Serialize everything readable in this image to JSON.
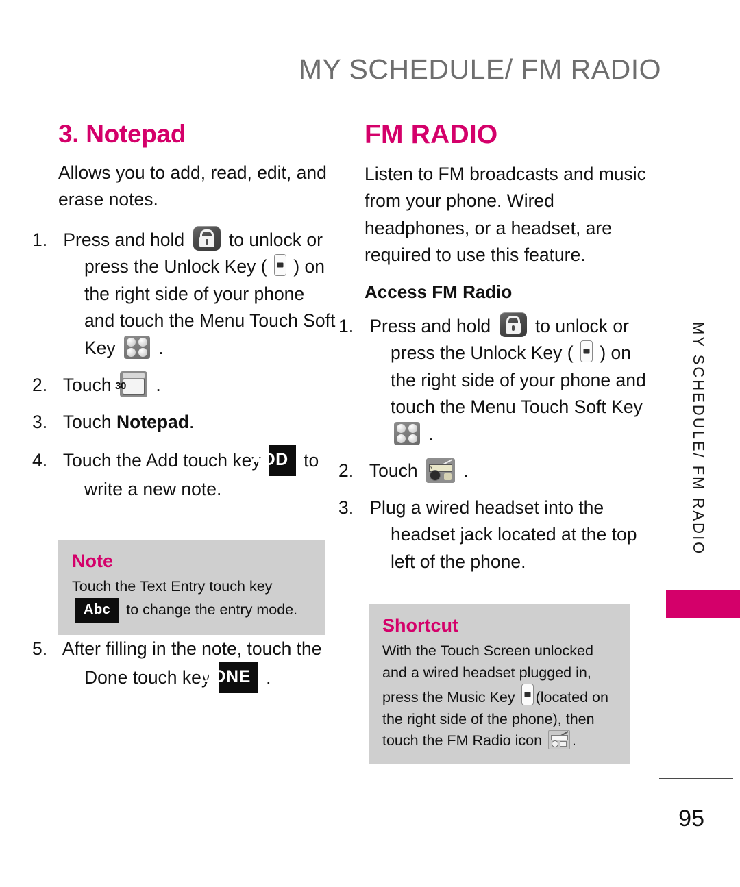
{
  "header": {
    "title": "MY SCHEDULE/ FM RADIO"
  },
  "side_tab": {
    "text": "MY SCHEDULE/ FM RADIO"
  },
  "footer": {
    "page_number": "95"
  },
  "colors": {
    "accent_magenta": "#D4006A",
    "header_gray": "#6E6E6E",
    "callout_bg": "#CFCFCF",
    "key_badge_bg": "#0D0D0D"
  },
  "left_column": {
    "heading": "3. Notepad",
    "intro": "Allows you to add, read, edit, and erase notes.",
    "steps": [
      {
        "num": "1.",
        "part1": "Press and hold",
        "part2": "to unlock or press the Unlock Key (",
        "part3": ") on the right side of your phone and touch the Menu Touch Soft Key",
        "part4": "."
      },
      {
        "num": "2.",
        "part1": "Touch",
        "part2": "."
      },
      {
        "num": "3.",
        "part1": "Touch",
        "bold": "Notepad",
        "part2": "."
      },
      {
        "num": "4.",
        "part1": "Touch the Add touch key",
        "badge": "ADD",
        "part2": "to write a new note."
      },
      {
        "num": "5.",
        "part1": "After filling in the note, touch the Done touch key",
        "badge": "DONE",
        "part2": "."
      }
    ],
    "note_box": {
      "title": "Note",
      "part1": "Touch the Text Entry touch key",
      "badge": "Abc",
      "part2": "to change the entry mode."
    }
  },
  "right_column": {
    "heading": "FM RADIO",
    "intro": "Listen to FM broadcasts and music from your phone. Wired headphones, or a headset, are required to use this feature.",
    "subheading": "Access FM Radio",
    "steps": [
      {
        "num": "1.",
        "part1": "Press and hold",
        "part2": "to unlock or press the Unlock Key (",
        "part3": ") on the right side of your phone and touch the Menu Touch Soft Key",
        "part4": "."
      },
      {
        "num": "2.",
        "part1": "Touch",
        "part2": "."
      },
      {
        "num": "3.",
        "part1": "Plug a wired headset into the headset jack located at the top left of the phone."
      }
    ],
    "shortcut_box": {
      "title": "Shortcut",
      "part1": "With the Touch Screen unlocked and a wired headset plugged in, press the Music Key",
      "part2": "(located on the right side of the phone), then touch the FM Radio icon",
      "part3": "."
    }
  },
  "icons": {
    "lock": "lock-icon",
    "side_key": "side-unlock-key-icon",
    "menu_soft_key": "menu-touch-soft-key-icon",
    "calendar": "calendar-icon",
    "calendar_day": "30",
    "radio": "fm-radio-icon",
    "radio_display": "95.5",
    "music_key": "music-key-icon"
  }
}
